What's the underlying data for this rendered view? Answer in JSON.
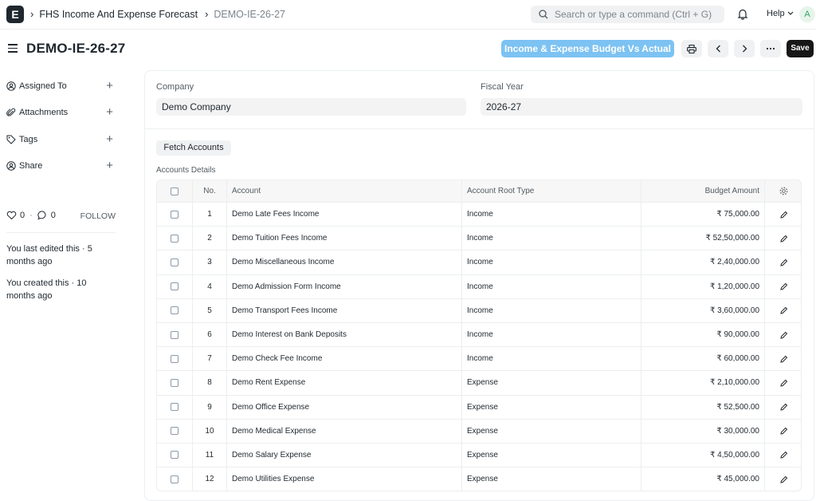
{
  "navbar": {
    "logo": "E",
    "breadcrumbs": [
      "FHS Income And Expense Forecast",
      "DEMO-IE-26-27"
    ],
    "search_placeholder": "Search or type a command (Ctrl + G)",
    "help_label": "Help",
    "avatar_initial": "A"
  },
  "page": {
    "title": "DEMO-IE-26-27",
    "report_button": "Income & Expense Budget Vs Actual",
    "save_label": "Save"
  },
  "sidebar": {
    "items": [
      {
        "label": "Assigned To",
        "icon": "user-plus-icon"
      },
      {
        "label": "Attachments",
        "icon": "paperclip-icon"
      },
      {
        "label": "Tags",
        "icon": "tag-icon"
      },
      {
        "label": "Share",
        "icon": "share-icon"
      }
    ],
    "likes": "0",
    "comments": "0",
    "follow_label": "FOLLOW",
    "activity": [
      "You last edited this · 5 months ago",
      "You created this · 10 months ago"
    ]
  },
  "form": {
    "company_label": "Company",
    "company_value": "Demo Company",
    "fiscal_year_label": "Fiscal Year",
    "fiscal_year_value": "2026-27",
    "fetch_button": "Fetch Accounts",
    "section_label": "Accounts Details"
  },
  "table": {
    "headers": {
      "no": "No.",
      "account": "Account",
      "root_type": "Account Root Type",
      "amount": "Budget Amount"
    },
    "rows": [
      {
        "no": "1",
        "account": "Demo Late Fees Income",
        "type": "Income",
        "amount": "₹ 75,000.00"
      },
      {
        "no": "2",
        "account": "Demo Tuition Fees Income",
        "type": "Income",
        "amount": "₹ 52,50,000.00"
      },
      {
        "no": "3",
        "account": "Demo Miscellaneous Income",
        "type": "Income",
        "amount": "₹ 2,40,000.00"
      },
      {
        "no": "4",
        "account": "Demo Admission Form Income",
        "type": "Income",
        "amount": "₹ 1,20,000.00"
      },
      {
        "no": "5",
        "account": "Demo Transport Fees Income",
        "type": "Income",
        "amount": "₹ 3,60,000.00"
      },
      {
        "no": "6",
        "account": "Demo Interest on Bank Deposits",
        "type": "Income",
        "amount": "₹ 90,000.00"
      },
      {
        "no": "7",
        "account": "Demo Check Fee Income",
        "type": "Income",
        "amount": "₹ 60,000.00"
      },
      {
        "no": "8",
        "account": "Demo Rent Expense",
        "type": "Expense",
        "amount": "₹ 2,10,000.00"
      },
      {
        "no": "9",
        "account": "Demo Office Expense",
        "type": "Expense",
        "amount": "₹ 52,500.00"
      },
      {
        "no": "10",
        "account": "Demo Medical Expense",
        "type": "Expense",
        "amount": "₹ 30,000.00"
      },
      {
        "no": "11",
        "account": "Demo Salary Expense",
        "type": "Expense",
        "amount": "₹ 4,50,000.00"
      },
      {
        "no": "12",
        "account": "Demo Utilities Expense",
        "type": "Expense",
        "amount": "₹ 45,000.00"
      }
    ]
  },
  "colors": {
    "accent": "#7cc2f2",
    "save": "#171717"
  }
}
